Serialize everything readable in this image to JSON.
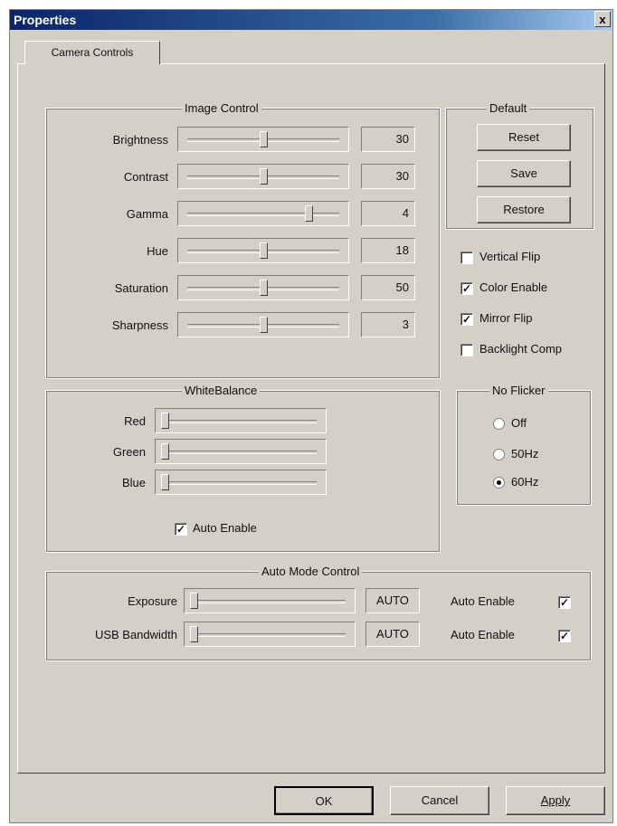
{
  "window": {
    "title": "Properties",
    "close_glyph": "x"
  },
  "tab": {
    "label": "Camera Controls"
  },
  "image_control": {
    "legend": "Image Control",
    "sliders": [
      {
        "label": "Brightness",
        "value": "30",
        "pos": 0.5
      },
      {
        "label": "Contrast",
        "value": "30",
        "pos": 0.5
      },
      {
        "label": "Gamma",
        "value": "4",
        "pos": 0.8
      },
      {
        "label": "Hue",
        "value": "18",
        "pos": 0.5
      },
      {
        "label": "Saturation",
        "value": "50",
        "pos": 0.5
      },
      {
        "label": "Sharpness",
        "value": "3",
        "pos": 0.5
      }
    ]
  },
  "default": {
    "legend": "Default",
    "reset": "Reset",
    "save": "Save",
    "restore": "Restore"
  },
  "options": [
    {
      "label": "Vertical Flip",
      "checked": false
    },
    {
      "label": "Color Enable",
      "checked": true
    },
    {
      "label": "Mirror Flip",
      "checked": true
    },
    {
      "label": "Backlight Comp",
      "checked": false
    }
  ],
  "white_balance": {
    "legend": "WhiteBalance",
    "sliders": [
      {
        "label": "Red",
        "pos": 0.0
      },
      {
        "label": "Green",
        "pos": 0.0
      },
      {
        "label": "Blue",
        "pos": 0.0
      }
    ],
    "auto_enable": {
      "label": "Auto Enable",
      "checked": true
    }
  },
  "no_flicker": {
    "legend": "No Flicker",
    "options": [
      {
        "label": "Off",
        "selected": false
      },
      {
        "label": "50Hz",
        "selected": false
      },
      {
        "label": "60Hz",
        "selected": true
      }
    ]
  },
  "auto_mode": {
    "legend": "Auto Mode Control",
    "rows": [
      {
        "label": "Exposure",
        "value": "AUTO",
        "auto_label": "Auto Enable",
        "auto_checked": true,
        "pos": 0.0
      },
      {
        "label": "USB Bandwidth",
        "value": "AUTO",
        "auto_label": "Auto Enable",
        "auto_checked": true,
        "pos": 0.0
      }
    ]
  },
  "buttons": {
    "ok": "OK",
    "cancel": "Cancel",
    "apply": "Apply"
  },
  "check_glyph": "✓"
}
